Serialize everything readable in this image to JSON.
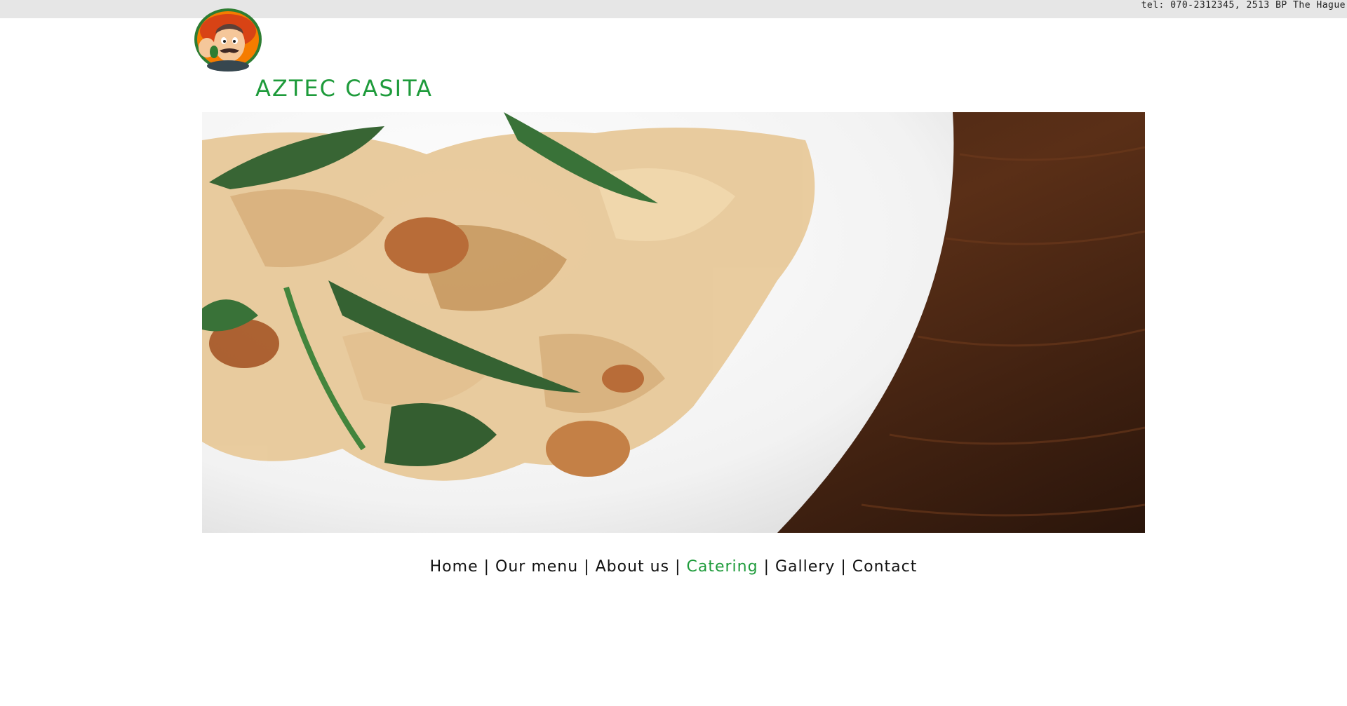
{
  "top_bar": {
    "contact_text": "tel: 070-2312345, 2513 BP The Hague"
  },
  "header": {
    "logo_icon": "mariachi-mascot-icon",
    "brand_name": "AZTEC CASITA"
  },
  "hero": {
    "image_icon": "pasta-dish-photo"
  },
  "nav": {
    "items": [
      {
        "label": "Home",
        "active": false
      },
      {
        "label": "Our menu",
        "active": false
      },
      {
        "label": "About us",
        "active": false
      },
      {
        "label": "Catering",
        "active": true
      },
      {
        "label": "Gallery",
        "active": false
      },
      {
        "label": "Contact",
        "active": false
      }
    ],
    "separator": "|"
  },
  "colors": {
    "brand_green": "#1e9b3b",
    "top_bar_bg": "#e6e6e6",
    "text": "#111111"
  }
}
